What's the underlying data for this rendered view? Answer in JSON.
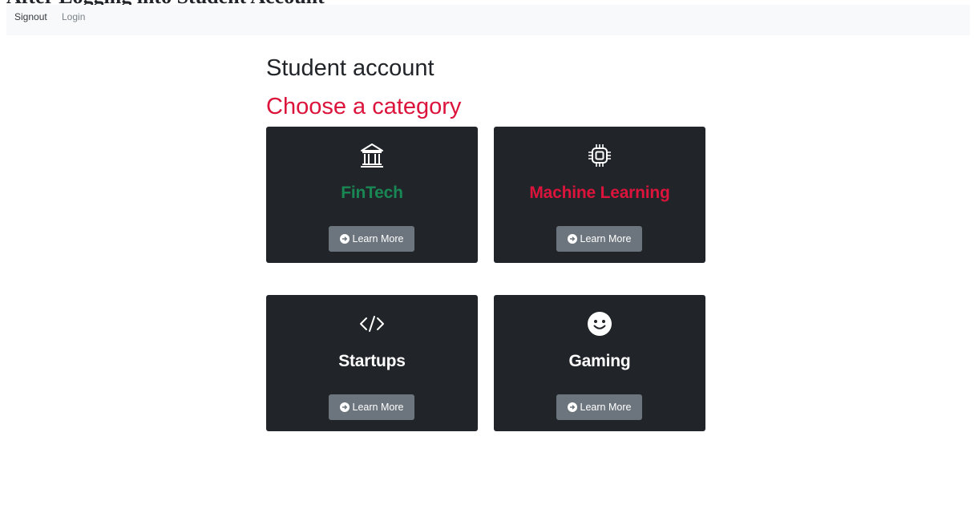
{
  "doc_heading": [
    "After",
    "Logging",
    "into",
    "Student",
    "Account"
  ],
  "nav": {
    "signout": "Signout",
    "login": "Login"
  },
  "page": {
    "title": "Student account",
    "subtitle": "Choose a category"
  },
  "cards": [
    {
      "title": "FinTech",
      "icon": "bank-icon",
      "title_color": "#198754",
      "button": "Learn More"
    },
    {
      "title": "Machine Learning",
      "icon": "cpu-icon",
      "title_color": "#dc143c",
      "button": "Learn More"
    },
    {
      "title": "Startups",
      "icon": "code-slash-icon",
      "title_color": "#ffffff",
      "button": "Learn More"
    },
    {
      "title": "Gaming",
      "icon": "smiley-icon",
      "title_color": "#ffffff",
      "button": "Learn More"
    }
  ],
  "colors": {
    "navbar_bg": "#f8f9fa",
    "card_bg": "#212529",
    "button_bg": "#6c757d",
    "accent_red": "#dc143c",
    "accent_green": "#198754"
  }
}
